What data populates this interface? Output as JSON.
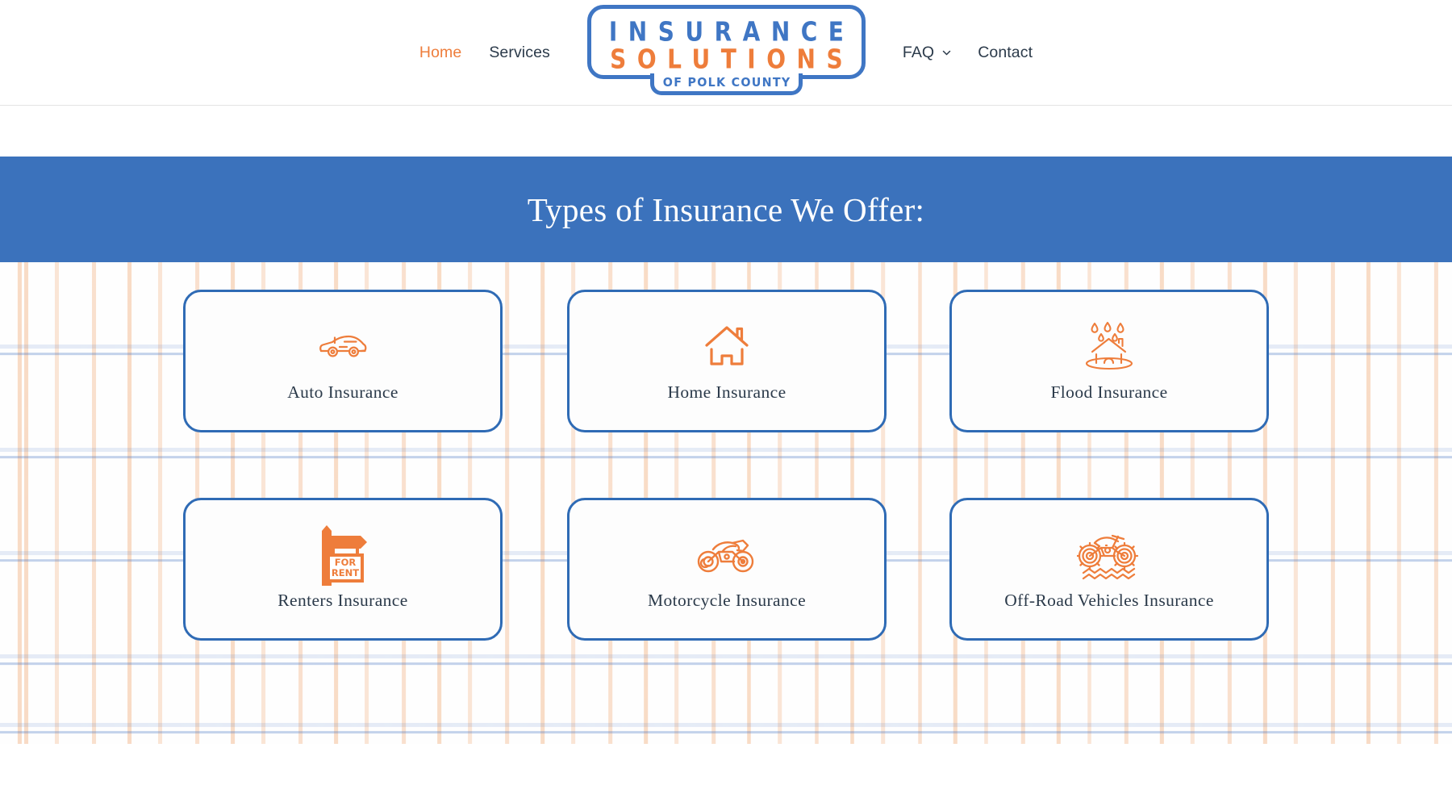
{
  "header": {
    "nav_left": [
      {
        "label": "Home",
        "active": true,
        "has_caret": false
      },
      {
        "label": "Services",
        "active": false,
        "has_caret": false
      }
    ],
    "nav_right": [
      {
        "label": "FAQ",
        "active": false,
        "has_caret": true
      },
      {
        "label": "Contact",
        "active": false,
        "has_caret": false
      }
    ],
    "logo": {
      "line1": "INSURANCE",
      "line2": "SOLUTIONS",
      "line3": "OF POLK COUNTY"
    }
  },
  "banner": {
    "title": "Types of Insurance We Offer:"
  },
  "cards": [
    {
      "label": "Auto Insurance",
      "icon": "car-icon"
    },
    {
      "label": "Home Insurance",
      "icon": "house-icon"
    },
    {
      "label": "Flood Insurance",
      "icon": "flood-house-icon"
    },
    {
      "label": "Renters Insurance",
      "icon": "for-rent-sign-icon"
    },
    {
      "label": "Motorcycle Insurance",
      "icon": "motorcycle-icon"
    },
    {
      "label": "Off-Road Vehicles Insurance",
      "icon": "dirt-bike-icon"
    }
  ],
  "icon_text": {
    "for": "FOR",
    "rent": "RENT"
  },
  "colors": {
    "brand_blue": "#3f76c4",
    "brand_orange": "#ee7d3b",
    "banner_blue": "#3b72bc",
    "card_border": "#2f6bb5",
    "text_dark": "#2b3a4a"
  }
}
